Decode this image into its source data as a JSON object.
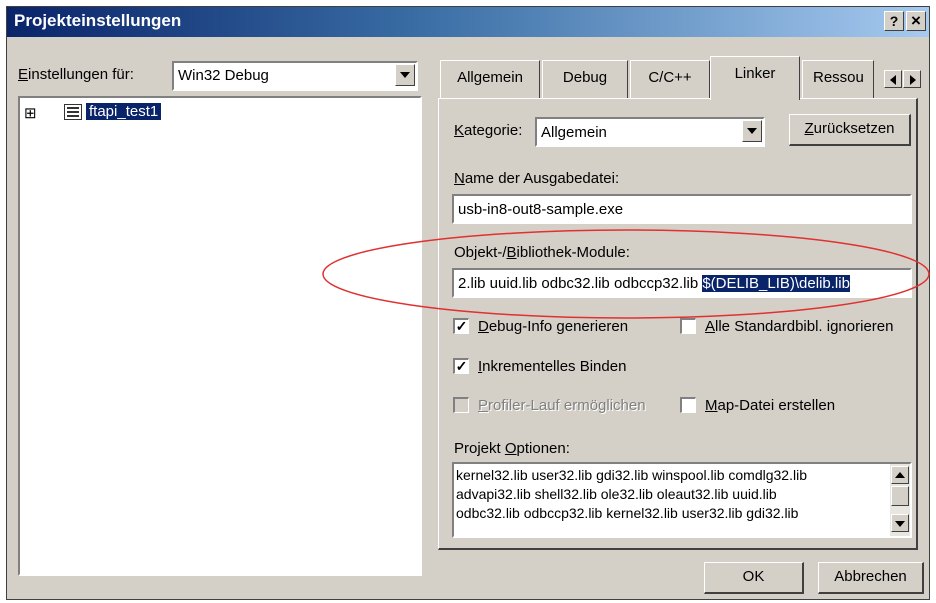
{
  "window": {
    "title": "Projekteinstellungen",
    "help_label": "?",
    "close_label": "×"
  },
  "left": {
    "settings_for_label_prefix": "E",
    "settings_for_label_rest": "instellungen für:",
    "config_value": "Win32 Debug",
    "tree": {
      "expander": "⊞",
      "item_label": "ftapi_test1"
    }
  },
  "tabs": [
    {
      "label": "Allgemein"
    },
    {
      "label": "Debug"
    },
    {
      "label": "C/C++"
    },
    {
      "label": "Linker"
    },
    {
      "label": "Ressou"
    }
  ],
  "active_tab": "Linker",
  "linker": {
    "kategorie_prefix": "K",
    "kategorie_rest": "ategorie:",
    "kategorie_value": "Allgemein",
    "reset_prefix": "Z",
    "reset_rest": "urücksetzen",
    "output_label_prefix": "N",
    "output_label_rest": "ame der Ausgabedatei:",
    "output_value": "usb-in8-out8-sample.exe",
    "modules_label_a": "Objekt-/",
    "modules_label_u": "B",
    "modules_label_b": "ibliothek-Module:",
    "modules_value_plain": "2.lib uuid.lib odbc32.lib odbccp32.lib ",
    "modules_value_selected": "$(DELIB_LIB)\\delib.lib",
    "debug_info_u": "D",
    "debug_info_rest": "ebug-Info generieren",
    "debug_info_checked": true,
    "ignore_libs_u": "A",
    "ignore_libs_rest": "lle Standardbibl. ignorieren",
    "ignore_libs_checked": false,
    "incremental_u": "I",
    "incremental_rest": "nkrementelles Binden",
    "incremental_checked": true,
    "profiler_u": "P",
    "profiler_rest": "rofiler-Lauf ermöglichen",
    "profiler_checked": false,
    "mapfile_u": "M",
    "mapfile_rest": "ap-Datei erstellen",
    "mapfile_checked": false,
    "options_label_a": "Projekt ",
    "options_label_u": "O",
    "options_label_b": "ptionen:",
    "options_lines": [
      "kernel32.lib user32.lib gdi32.lib winspool.lib comdlg32.lib",
      "advapi32.lib shell32.lib ole32.lib oleaut32.lib uuid.lib",
      "odbc32.lib odbccp32.lib kernel32.lib user32.lib gdi32.lib"
    ]
  },
  "buttons": {
    "ok": "OK",
    "cancel": "Abbrechen"
  },
  "colors": {
    "title_gradient_start": "#0a246a",
    "title_gradient_end": "#a6caf0",
    "dialog_face": "#d4d0c8",
    "selection": "#0a246a",
    "annotation_ellipse": "#e03030"
  }
}
